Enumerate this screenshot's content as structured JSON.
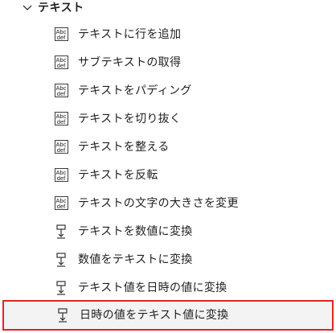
{
  "group": {
    "title": "テキスト",
    "expand_icon": "chevron-down-icon"
  },
  "items": [
    {
      "label": "テキストに行を追加",
      "icon": "abc-def-text-icon",
      "icon_top": "Abc",
      "icon_bottom": "def"
    },
    {
      "label": "サブテキストの取得",
      "icon": "abc-def-text-icon",
      "icon_top": "Abc",
      "icon_bottom": "def"
    },
    {
      "label": "テキストをパディング",
      "icon": "abc-def-text-icon",
      "icon_top": "Abc",
      "icon_bottom": "def"
    },
    {
      "label": "テキストを切り抜く",
      "icon": "abc-def-text-icon",
      "icon_top": "Abc",
      "icon_bottom": "def"
    },
    {
      "label": "テキストを整える",
      "icon": "abc-def-text-icon",
      "icon_top": "Abc",
      "icon_bottom": "def"
    },
    {
      "label": "テキストを反転",
      "icon": "abc-def-text-icon",
      "icon_top": "Abc",
      "icon_bottom": "def"
    },
    {
      "label": "テキストの文字の大きさを変更",
      "icon": "abc-def-text-icon",
      "icon_top": "Abc",
      "icon_bottom": "def"
    },
    {
      "label": "テキストを数値に変換",
      "icon": "convert-icon"
    },
    {
      "label": "数値をテキストに変換",
      "icon": "convert-icon"
    },
    {
      "label": "テキスト値を日時の値に変換",
      "icon": "convert-icon"
    },
    {
      "label": "日時の値をテキスト値に変換",
      "icon": "convert-icon",
      "highlighted": true
    }
  ],
  "colors": {
    "highlight_border": "#e02424",
    "highlight_background": "#f3f3f3",
    "text": "#1f1f1f"
  }
}
